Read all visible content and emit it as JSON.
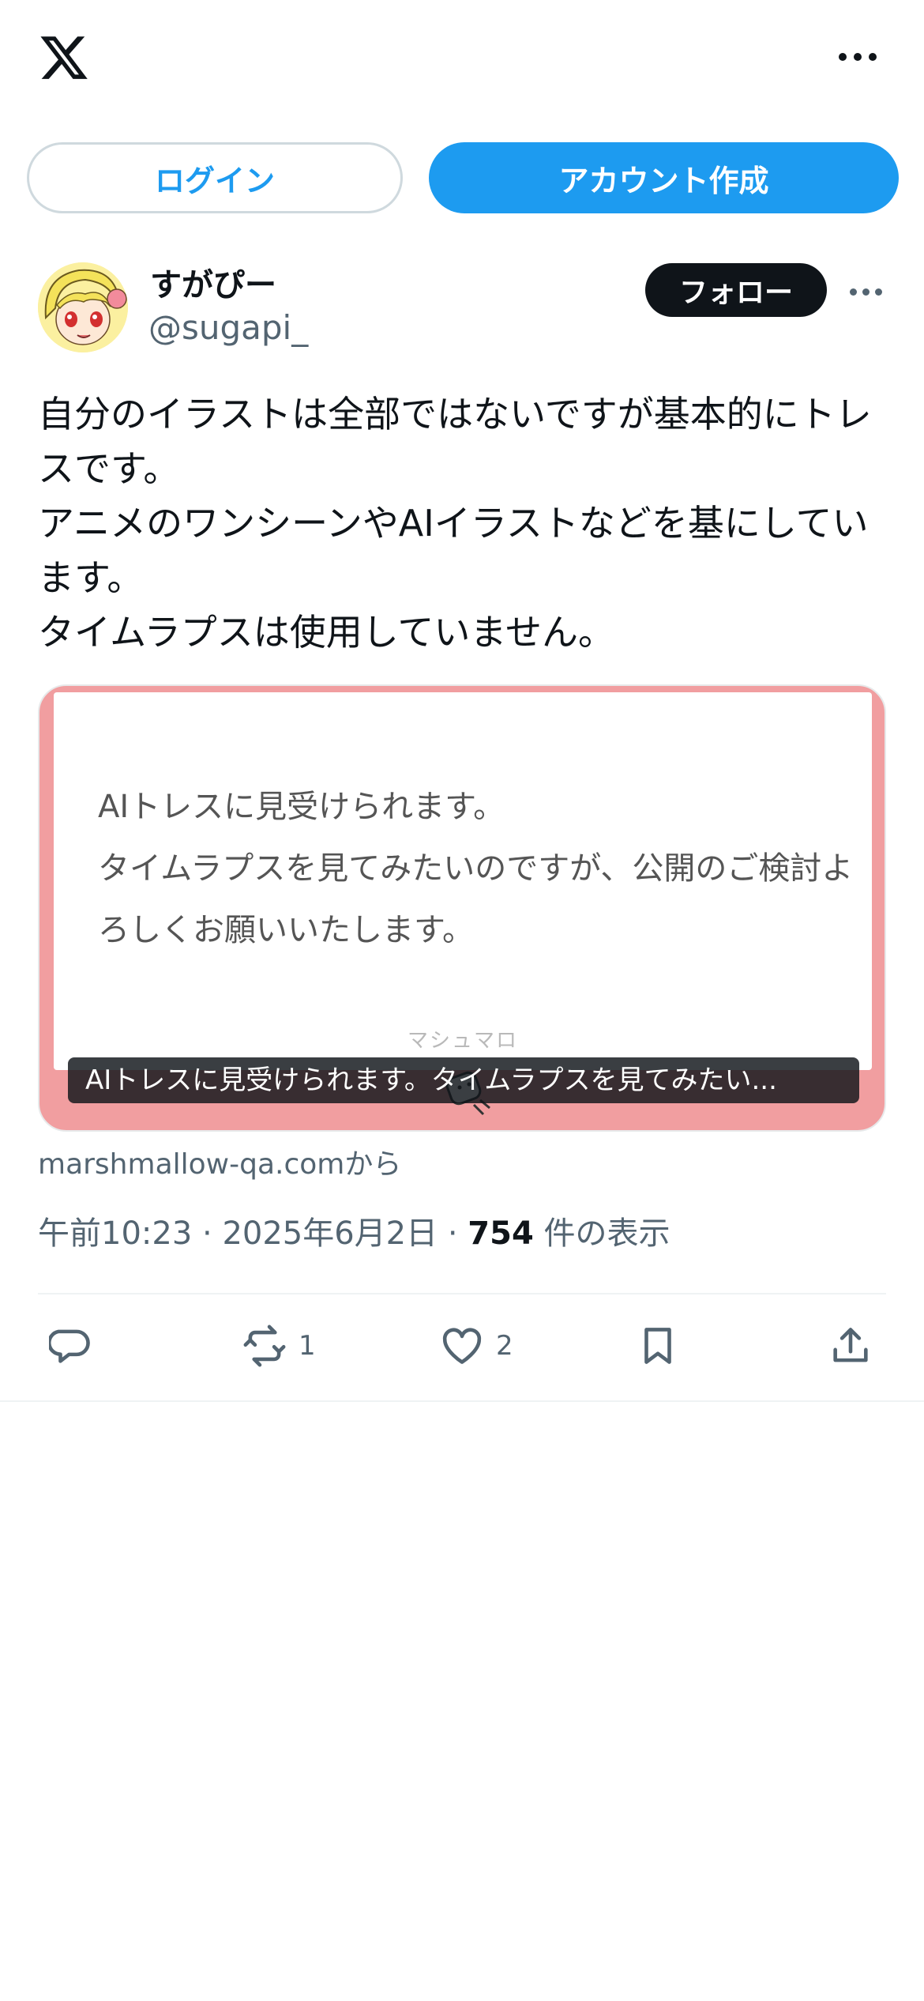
{
  "top_bar": {
    "logo_icon": "x-logo-icon",
    "more_icon": "more-horizontal-icon"
  },
  "auth": {
    "login_label": "ログイン",
    "signup_label": "アカウント作成"
  },
  "author": {
    "display_name": "すがぴー",
    "handle": "@sugapi_",
    "follow_label": "フォロー"
  },
  "tweet": {
    "text": "自分のイラストは全部ではないですが基本的にトレスです。\nアニメのワンシーンやAIイラストなどを基にしています。\nタイムラプスは使用していません。"
  },
  "card": {
    "question": "AIトレスに見受けられます。\nタイムラプスを見てみたいのですが、公開のご検討よろしくお願いいたします。",
    "brand": "マシュマロ",
    "caption": "AIトレスに見受けられます。タイムラプスを見てみたい...",
    "source": "marshmallow-qa.comから"
  },
  "meta": {
    "time": "午前10:23",
    "date": "2025年6月2日",
    "views_count": "754",
    "views_label": "件の表示",
    "separator": "·"
  },
  "actions": {
    "reply_count": "",
    "retweet_count": "1",
    "like_count": "2"
  },
  "colors": {
    "accent": "#1d9bf0",
    "text": "#0f1419",
    "muted": "#536471",
    "card_frame": "#f19ea0"
  }
}
